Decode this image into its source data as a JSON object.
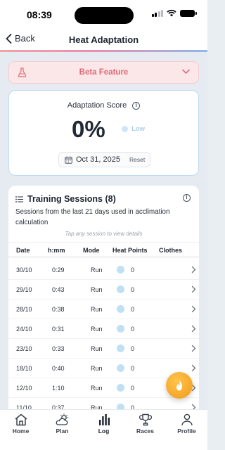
{
  "status_bar": {
    "time": "08:39"
  },
  "nav": {
    "back_label": "Back",
    "title": "Heat Adaptation"
  },
  "beta_banner": {
    "label": "Beta Feature",
    "icon": "flask-icon"
  },
  "score_card": {
    "title": "Adaptation Score",
    "value": "0%",
    "level": "Low",
    "date": "Oct 31, 2025",
    "reset_label": "Reset"
  },
  "sessions": {
    "title": "Training Sessions (8)",
    "description": "Sessions from the last 21 days used in acclimation calculation",
    "hint": "Tap any session to view details",
    "columns": [
      "Date",
      "h:mm",
      "Mode",
      "Heat Points",
      "Clothes"
    ],
    "rows": [
      {
        "date": "30/10",
        "duration": "0:29",
        "mode": "Run",
        "points": "0"
      },
      {
        "date": "29/10",
        "duration": "0:43",
        "mode": "Run",
        "points": "0"
      },
      {
        "date": "28/10",
        "duration": "0:38",
        "mode": "Run",
        "points": "0"
      },
      {
        "date": "24/10",
        "duration": "0:31",
        "mode": "Run",
        "points": "0"
      },
      {
        "date": "23/10",
        "duration": "0:33",
        "mode": "Run",
        "points": "0"
      },
      {
        "date": "18/10",
        "duration": "0:40",
        "mode": "Run",
        "points": "0"
      },
      {
        "date": "12/10",
        "duration": "1:10",
        "mode": "Run",
        "points": "0"
      },
      {
        "date": "11/10",
        "duration": "0:37",
        "mode": "Run",
        "points": "0"
      }
    ]
  },
  "fab": {
    "icon": "flame-icon"
  },
  "tabs": [
    {
      "label": "Home",
      "icon": "home-icon",
      "active": false
    },
    {
      "label": "Plan",
      "icon": "weather-icon",
      "active": false
    },
    {
      "label": "Log",
      "icon": "bar-chart-icon",
      "active": true
    },
    {
      "label": "Races",
      "icon": "trophy-icon",
      "active": false
    },
    {
      "label": "Profile",
      "icon": "person-icon",
      "active": false
    }
  ],
  "colors": {
    "beta_text": "#e06b79",
    "beta_bg": "#fbe6e8",
    "score_border": "#bcdaf2",
    "level_color": "#a9cdee",
    "fab": "#f29a17"
  }
}
